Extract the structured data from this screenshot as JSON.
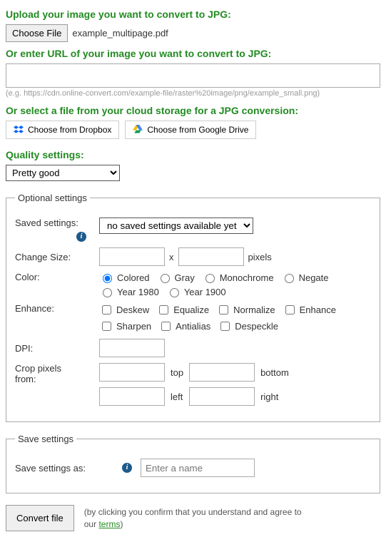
{
  "upload": {
    "heading": "Upload your image you want to convert to JPG:",
    "choose_btn": "Choose File",
    "filename": "example_multipage.pdf"
  },
  "url": {
    "heading": "Or enter URL of your image you want to convert to JPG:",
    "value": "",
    "example": "(e.g. https://cdn.online-convert.com/example-file/raster%20image/png/example_small.png)"
  },
  "cloud": {
    "heading": "Or select a file from your cloud storage for a JPG conversion:",
    "dropbox": "Choose from Dropbox",
    "gdrive": "Choose from Google Drive"
  },
  "quality": {
    "heading": "Quality settings:",
    "selected": "Pretty good"
  },
  "optional": {
    "legend": "Optional settings",
    "saved_label": "Saved settings:",
    "saved_selected": "no saved settings available yet",
    "size_label": "Change Size:",
    "x": "x",
    "pixels": "pixels",
    "color_label": "Color:",
    "colors": {
      "colored": "Colored",
      "gray": "Gray",
      "monochrome": "Monochrome",
      "negate": "Negate",
      "y1980": "Year 1980",
      "y1900": "Year 1900"
    },
    "enhance_label": "Enhance:",
    "enhance": {
      "deskew": "Deskew",
      "equalize": "Equalize",
      "normalize": "Normalize",
      "enhance": "Enhance",
      "sharpen": "Sharpen",
      "antialias": "Antialias",
      "despeckle": "Despeckle"
    },
    "dpi_label": "DPI:",
    "crop_label1": "Crop pixels",
    "crop_label2": "from:",
    "top": "top",
    "bottom": "bottom",
    "left": "left",
    "right": "right"
  },
  "save": {
    "legend": "Save settings",
    "label": "Save settings as:",
    "placeholder": "Enter a name"
  },
  "convert": {
    "btn": "Convert file",
    "disclaimer_pre": "(by clicking you confirm that you understand and agree to our ",
    "terms": "terms",
    "disclaimer_post": ")"
  }
}
